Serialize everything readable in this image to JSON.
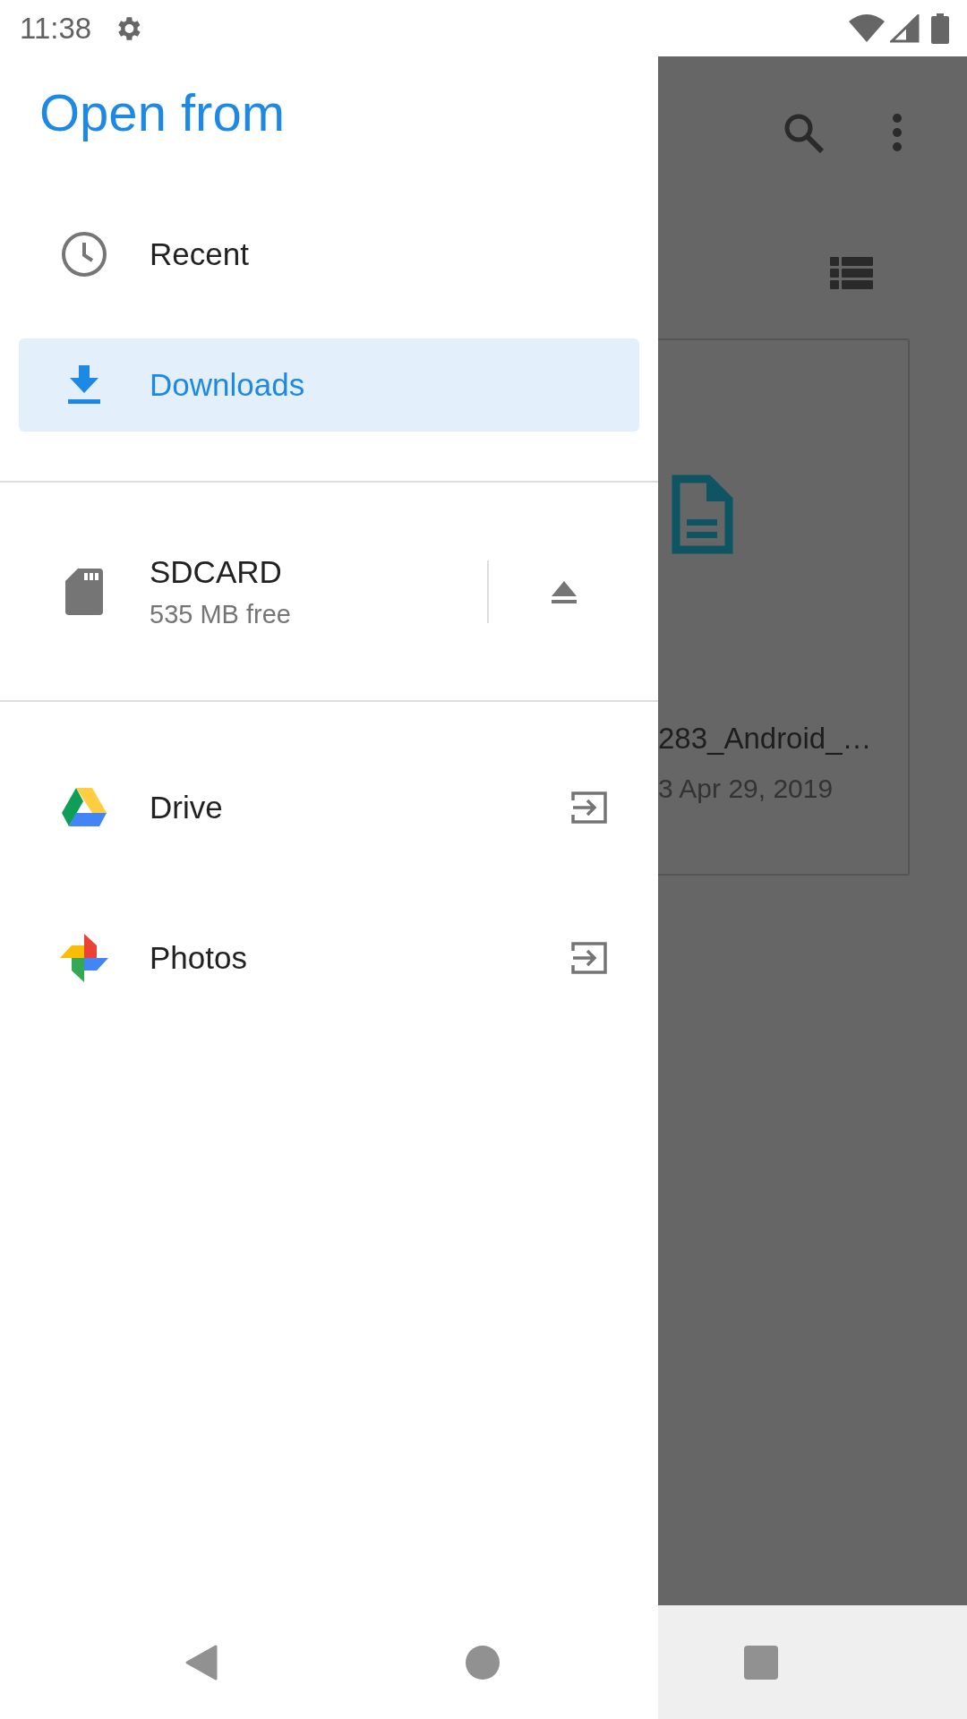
{
  "status_bar": {
    "time": "11:38"
  },
  "drawer": {
    "title": "Open from",
    "sections": [
      {
        "items": [
          {
            "kind": "recent",
            "label": "Recent",
            "selected": false
          },
          {
            "kind": "downloads",
            "label": "Downloads",
            "selected": true
          }
        ]
      },
      {
        "items": [
          {
            "kind": "storage",
            "label": "SDCARD",
            "detail": "535 MB free",
            "selected": false
          }
        ]
      },
      {
        "items": [
          {
            "kind": "drive",
            "label": "Drive",
            "selected": false
          },
          {
            "kind": "photos",
            "label": "Photos",
            "selected": false
          }
        ]
      }
    ]
  },
  "background": {
    "file": {
      "name": "283_Android_…",
      "meta": "3 Apr 29, 2019"
    }
  }
}
